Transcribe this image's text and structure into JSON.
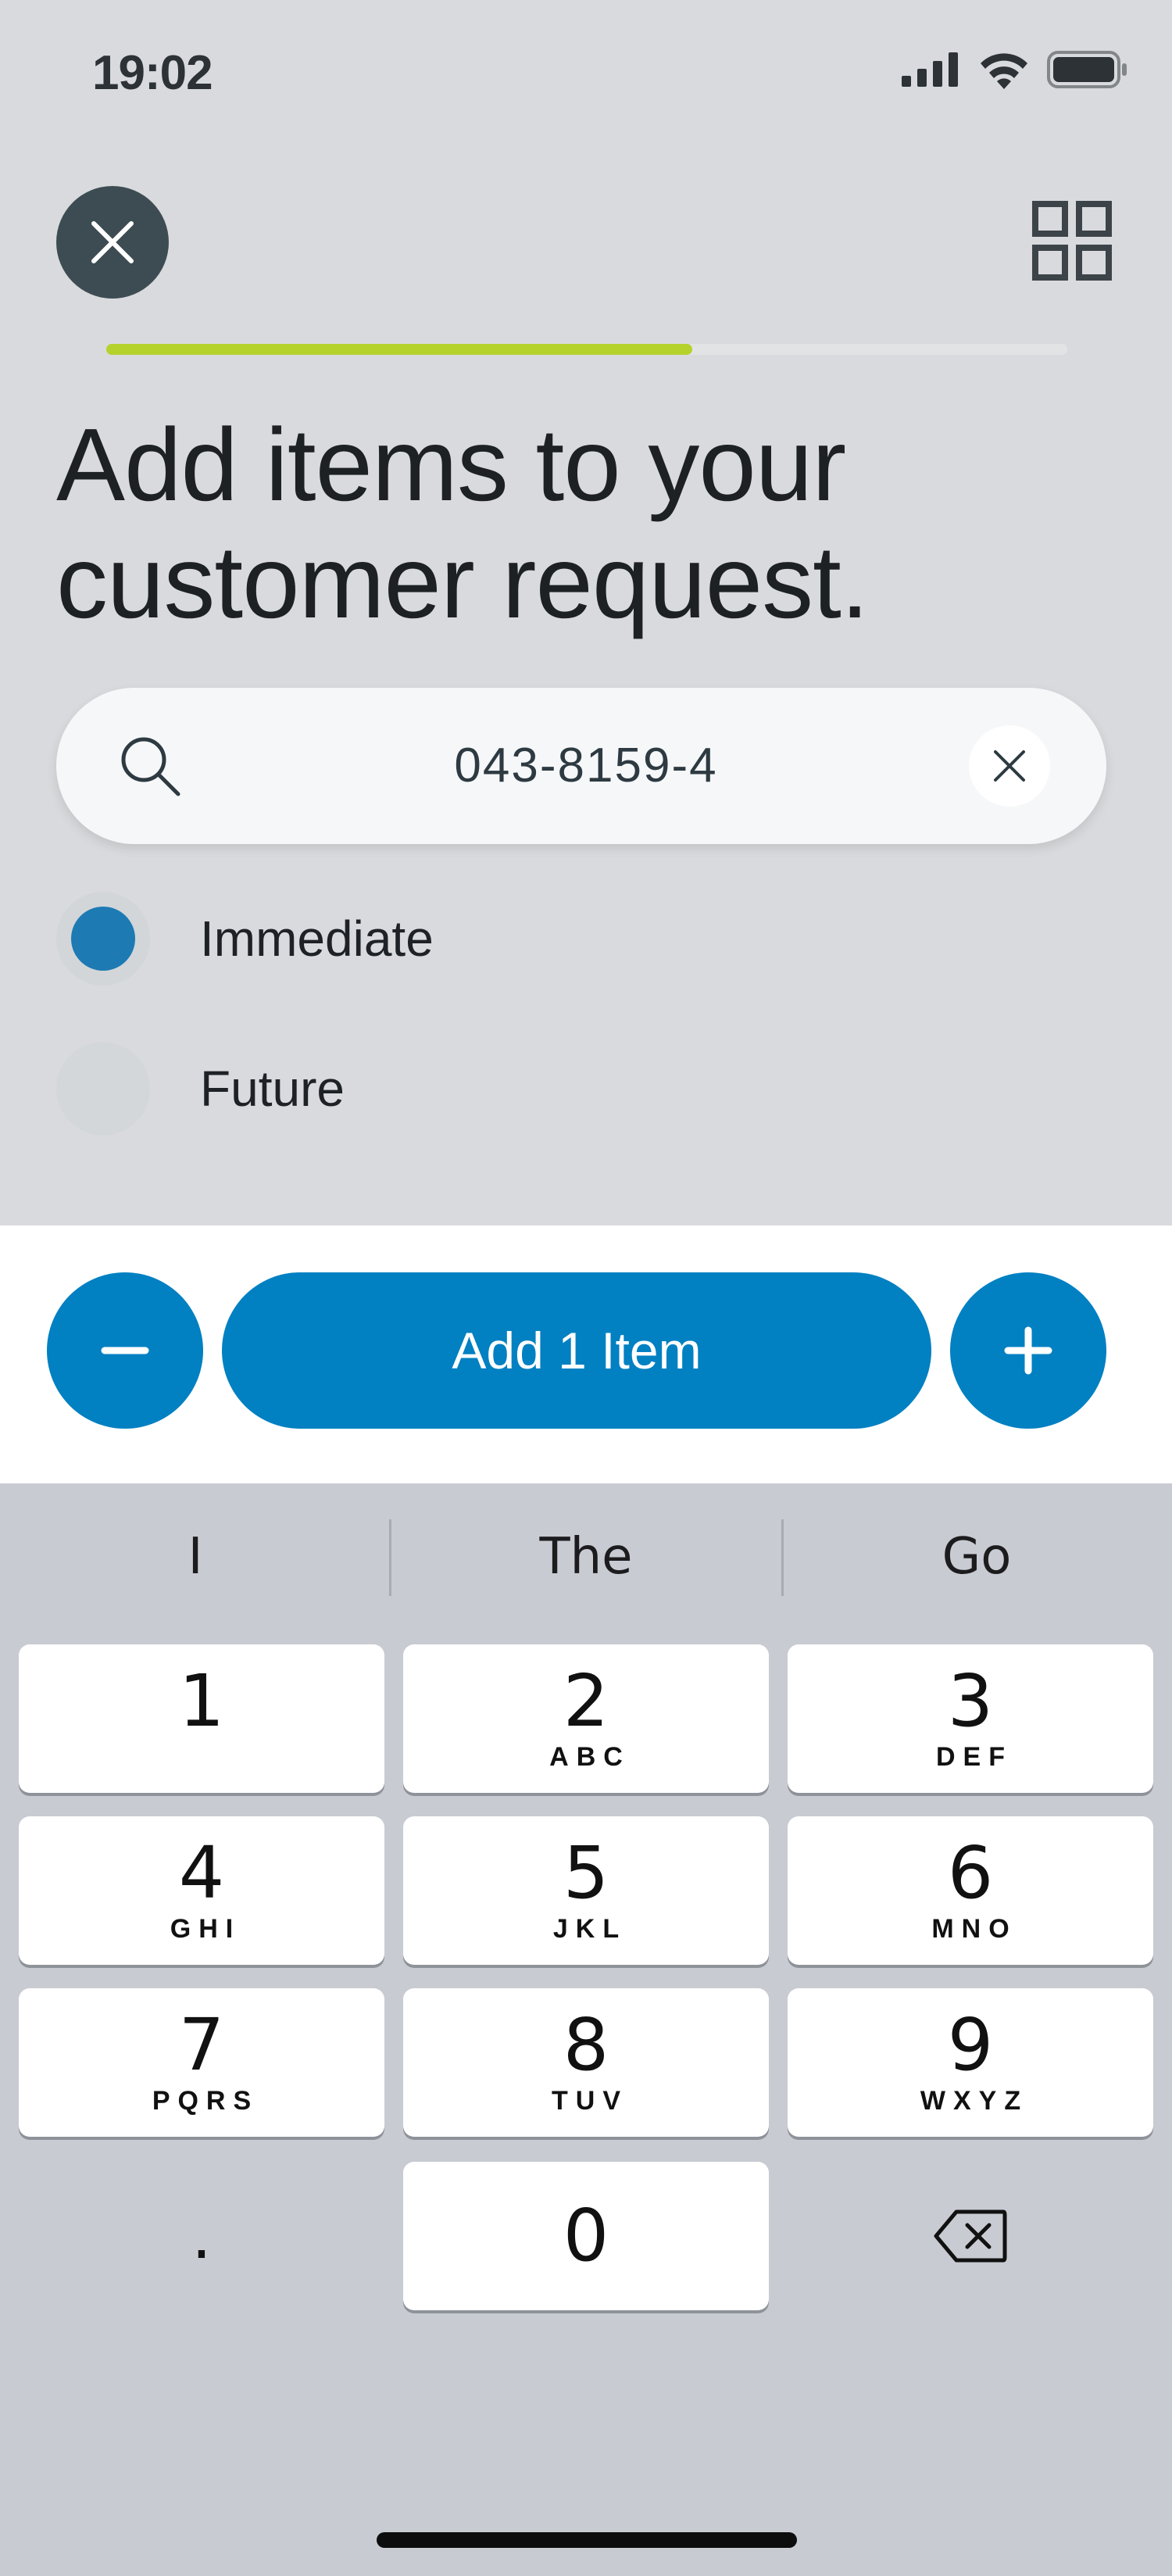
{
  "status_bar": {
    "time": "19:02"
  },
  "header": {
    "close_icon": "close-icon",
    "scan_icon": "qr-grid-icon",
    "progress_percent": 61
  },
  "page": {
    "title": "Add items to your customer request."
  },
  "search": {
    "value": "043-8159-4",
    "icon": "search-icon",
    "clear_icon": "close-icon"
  },
  "options": [
    {
      "label": "Immediate",
      "selected": true
    },
    {
      "label": "Future",
      "selected": false
    }
  ],
  "action_bar": {
    "decrement_icon": "minus-icon",
    "add_label": "Add 1 Item",
    "increment_icon": "plus-icon"
  },
  "keyboard": {
    "suggestions": [
      "I",
      "The",
      "Go"
    ],
    "keys": [
      {
        "num": "1",
        "letters": ""
      },
      {
        "num": "2",
        "letters": "ABC"
      },
      {
        "num": "3",
        "letters": "DEF"
      },
      {
        "num": "4",
        "letters": "GHI"
      },
      {
        "num": "5",
        "letters": "JKL"
      },
      {
        "num": "6",
        "letters": "MNO"
      },
      {
        "num": "7",
        "letters": "PQRS"
      },
      {
        "num": "8",
        "letters": "TUV"
      },
      {
        "num": "9",
        "letters": "WXYZ"
      }
    ],
    "dot": ".",
    "zero": "0",
    "backspace_icon": "backspace-icon"
  },
  "colors": {
    "accent": "#0180C2",
    "progress": "#B5D22C",
    "radio_selected": "#1D7AB3"
  }
}
